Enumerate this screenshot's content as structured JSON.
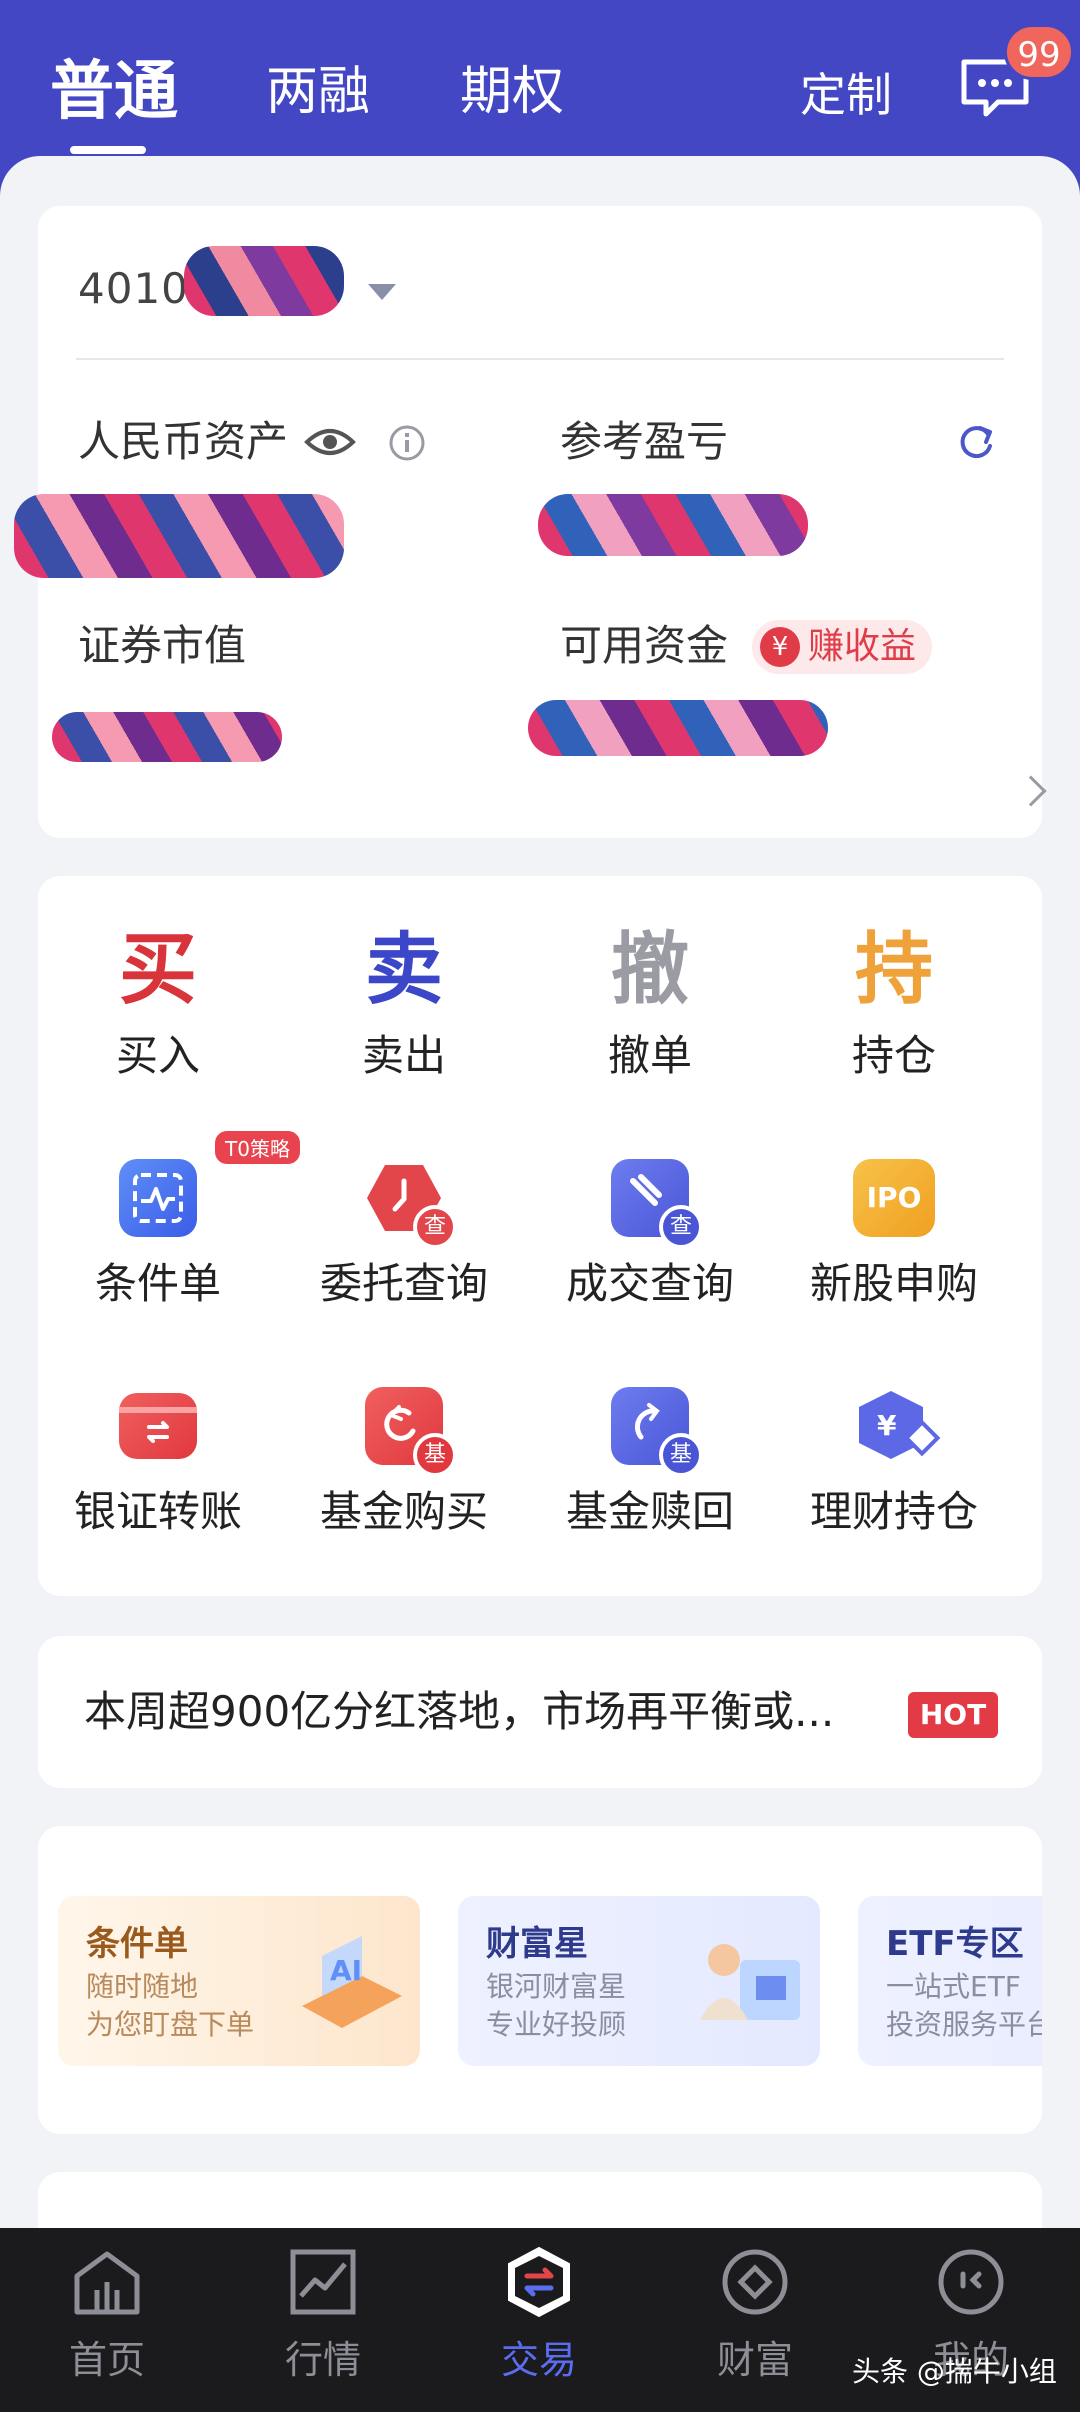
{
  "header": {
    "tabs": [
      {
        "label": "普通",
        "active": true
      },
      {
        "label": "两融",
        "active": false
      },
      {
        "label": "期权",
        "active": false
      }
    ],
    "customize_label": "定制",
    "message_badge": "99"
  },
  "account": {
    "number_visible": "401000",
    "rmb_assets_label": "人民币资产",
    "reference_pl_label": "参考盈亏",
    "securities_value_label": "证券市值",
    "available_funds_label": "可用资金",
    "earn_yield_label": "赚收益",
    "yen_symbol": "¥"
  },
  "trade_actions": [
    {
      "char": "买",
      "label": "买入",
      "color": "#d8343a"
    },
    {
      "char": "卖",
      "label": "卖出",
      "color": "#3b46c8"
    },
    {
      "char": "撤",
      "label": "撤单",
      "color": "#9a9ba3"
    },
    {
      "char": "持",
      "label": "持仓",
      "color": "#f0a23a"
    }
  ],
  "functions_row1": [
    {
      "label": "条件单",
      "icon": "condition-order-icon",
      "badge": "T0策略"
    },
    {
      "label": "委托查询",
      "icon": "order-query-icon",
      "sub": "查"
    },
    {
      "label": "成交查询",
      "icon": "deal-query-icon",
      "sub": "查"
    },
    {
      "label": "新股申购",
      "icon": "ipo-icon",
      "tile_text": "IPO"
    }
  ],
  "functions_row2": [
    {
      "label": "银证转账",
      "icon": "bank-transfer-icon"
    },
    {
      "label": "基金购买",
      "icon": "fund-buy-icon",
      "sub": "基"
    },
    {
      "label": "基金赎回",
      "icon": "fund-redeem-icon",
      "sub": "基"
    },
    {
      "label": "理财持仓",
      "icon": "wealth-holdings-icon"
    }
  ],
  "news": {
    "text": "本周超900亿分红落地，市场再平衡或...",
    "badge": "HOT"
  },
  "promos": [
    {
      "title": "条件单",
      "line1": "随时随地",
      "line2": "为您盯盘下单"
    },
    {
      "title": "财富星",
      "line1": "银河财富星",
      "line2": "专业好投顾"
    },
    {
      "title": "ETF专区",
      "line1": "一站式ETF",
      "line2": "投资服务平台"
    }
  ],
  "bottom_nav": [
    {
      "label": "首页",
      "icon": "home-icon",
      "active": false
    },
    {
      "label": "行情",
      "icon": "market-chart-icon",
      "active": false
    },
    {
      "label": "交易",
      "icon": "trade-icon",
      "active": true
    },
    {
      "label": "财富",
      "icon": "wealth-icon",
      "active": false
    },
    {
      "label": "我的",
      "icon": "profile-icon",
      "active": false
    }
  ],
  "watermark": "头条 @揣牛小组"
}
